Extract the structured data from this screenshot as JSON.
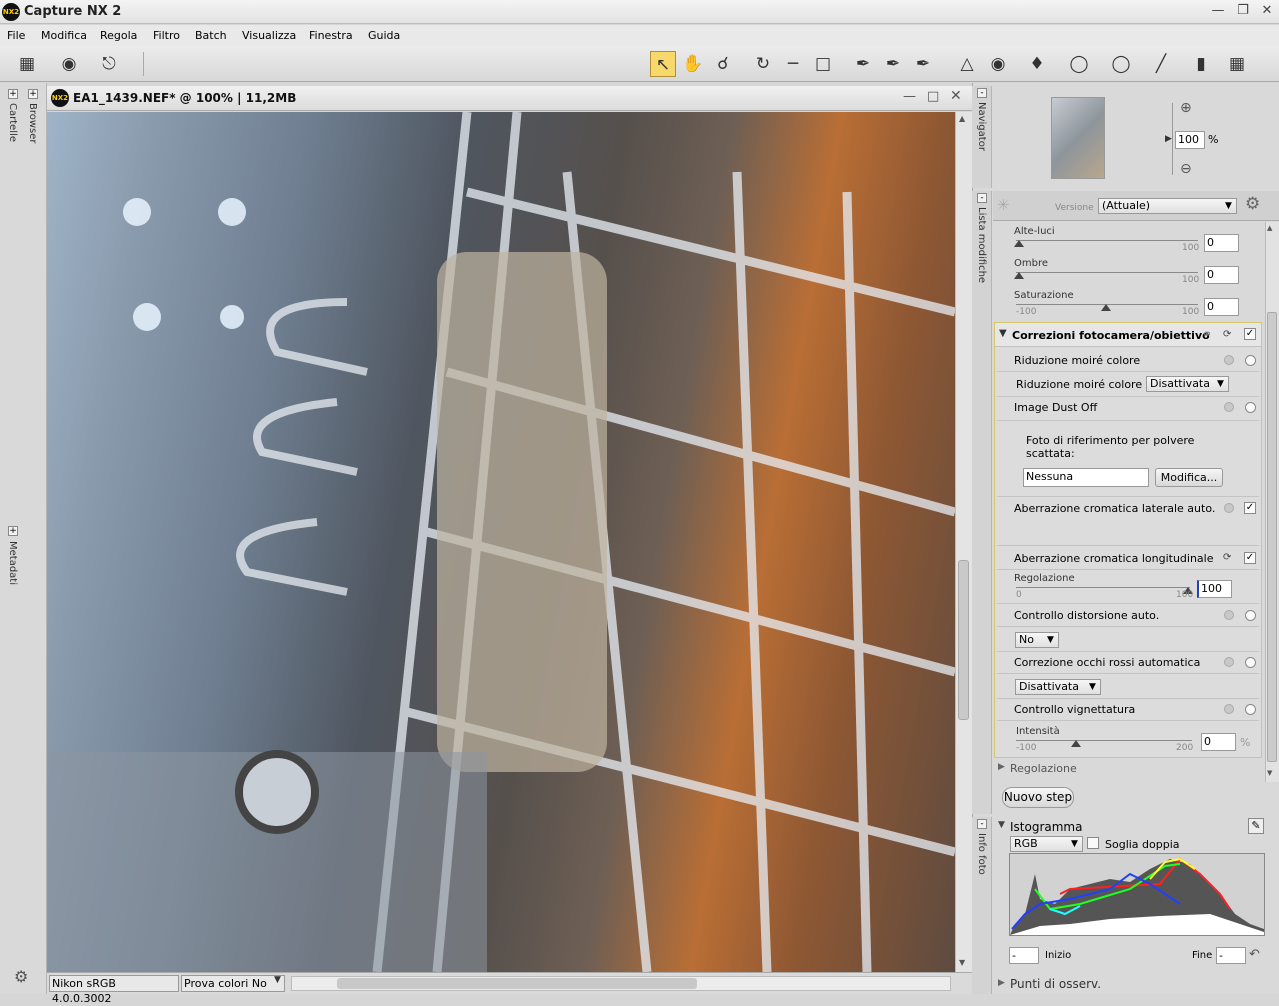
{
  "app": {
    "title": "Capture NX 2",
    "icon_text": "NX2"
  },
  "menu": [
    "File",
    "Modifica",
    "Regola",
    "Filtro",
    "Batch",
    "Visualizza",
    "Finestra",
    "Guida"
  ],
  "left_panels": {
    "cartelle": "Cartelle",
    "browser": "Browser",
    "metadati": "Metadati"
  },
  "document": {
    "title": "EA1_1439.NEF* @ 100% | 11,2MB"
  },
  "status": {
    "profile": "Nikon sRGB 4.0.0.3002",
    "proof": "Prova colori No"
  },
  "navigator": {
    "label": "Navigator",
    "zoom": "100",
    "unit": "%"
  },
  "edit_list": {
    "label": "Lista modifiche",
    "version_label": "Versione",
    "version_value": "(Attuale)",
    "highlights": {
      "label": "Alte-luci",
      "max": "100",
      "value": "0"
    },
    "shadows": {
      "label": "Ombre",
      "max": "100",
      "value": "0"
    },
    "saturation": {
      "label": "Saturazione",
      "min": "-100",
      "max": "100",
      "value": "0"
    },
    "section_title": "Correzioni fotocamera/obiettivo",
    "moire": {
      "title": "Riduzione moiré colore",
      "label": "Riduzione moiré colore",
      "value": "Disattivata"
    },
    "dust": {
      "title": "Image Dust Off",
      "desc": "Foto di riferimento per polvere scattata:",
      "value": "Nessuna",
      "button": "Modifica..."
    },
    "lateral_ca": {
      "title": "Aberrazione cromatica laterale auto."
    },
    "longitudinal_ca": {
      "title": "Aberrazione cromatica longitudinale",
      "label": "Regolazione",
      "min": "0",
      "max": "100",
      "value": "100"
    },
    "distortion": {
      "title": "Controllo distorsione auto.",
      "value": "No"
    },
    "redeye": {
      "title": "Correzione occhi rossi automatica",
      "value": "Disattivata"
    },
    "vignette": {
      "title": "Controllo vignettatura",
      "label": "Intensità",
      "min": "-100",
      "max": "200",
      "value": "0",
      "unit": "%"
    },
    "adjust": "Regolazione",
    "new_step": "Nuovo step"
  },
  "info": {
    "label": "Info foto",
    "histogram_title": "Istogramma",
    "channel": "RGB",
    "dual_threshold": "Soglia doppia",
    "start_label": "Inizio",
    "end_label": "Fine",
    "start_value": "-",
    "end_value": "-"
  },
  "watch_points": "Punti di osserv."
}
